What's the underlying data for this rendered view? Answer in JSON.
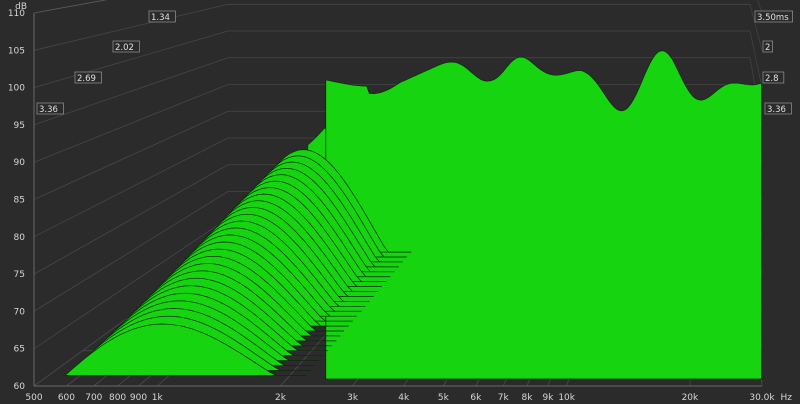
{
  "chart_data": {
    "type": "area",
    "subtype": "waterfall-3d",
    "y_unit": "dB",
    "x_unit": "Hz",
    "x_scale": "log",
    "y_ticks": [
      60,
      65,
      70,
      75,
      80,
      85,
      90,
      95,
      100,
      105,
      110
    ],
    "x_ticks": [
      {
        "v": 500,
        "label": "500"
      },
      {
        "v": 600,
        "label": "600"
      },
      {
        "v": 700,
        "label": "700"
      },
      {
        "v": 800,
        "label": "800"
      },
      {
        "v": 900,
        "label": "900"
      },
      {
        "v": 1000,
        "label": "1k"
      },
      {
        "v": 2000,
        "label": "2k"
      },
      {
        "v": 3000,
        "label": "3k"
      },
      {
        "v": 4000,
        "label": "4k"
      },
      {
        "v": 5000,
        "label": "5k"
      },
      {
        "v": 6000,
        "label": "6k"
      },
      {
        "v": 7000,
        "label": "7k"
      },
      {
        "v": 8000,
        "label": "8k"
      },
      {
        "v": 9000,
        "label": "9k"
      },
      {
        "v": 10000,
        "label": "10k"
      },
      {
        "v": 20000,
        "label": "20k"
      },
      {
        "v": 30000,
        "label": "30.0k"
      }
    ],
    "time_labels_left": [
      "1.34",
      "2.02",
      "2.69",
      "3.36"
    ],
    "time_labels_right": [
      "3.50ms",
      "2",
      "2.8",
      "3.36"
    ],
    "xlim": [
      500,
      30000
    ],
    "ylim": [
      60,
      110
    ],
    "time_range_ms": [
      0,
      3.5
    ],
    "fill_color": "#16d40f",
    "line_color": "#0a2a0a",
    "background_color": "#2b2b2b",
    "grid": true
  }
}
